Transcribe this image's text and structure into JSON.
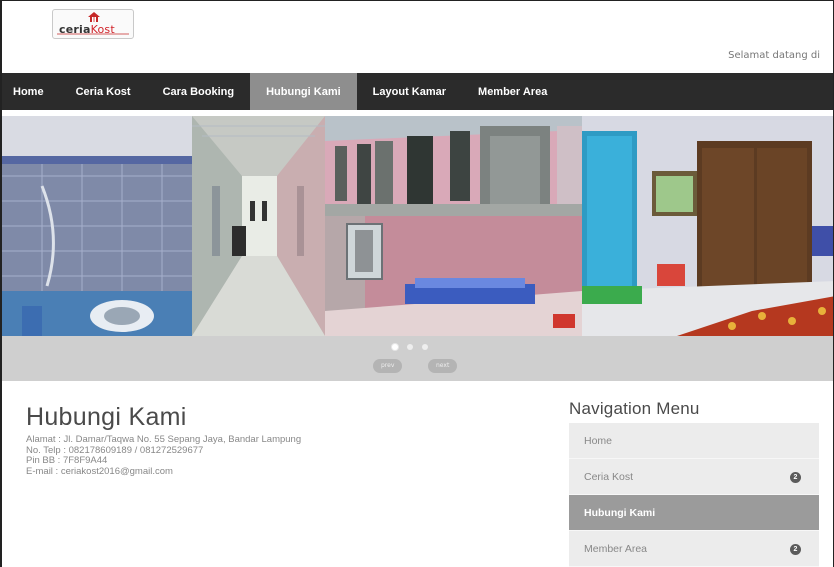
{
  "header": {
    "logo": {
      "part1": "ceria",
      "part2": "Kost"
    },
    "greeting": "Selamat datang di"
  },
  "nav": {
    "items": [
      {
        "label": "Home"
      },
      {
        "label": "Ceria Kost"
      },
      {
        "label": "Cara Booking"
      },
      {
        "label": "Hubungi Kami",
        "active": true
      },
      {
        "label": "Layout Kamar"
      },
      {
        "label": "Member Area"
      }
    ]
  },
  "slider": {
    "prev_label": "prev",
    "next_label": "next",
    "dots": 3,
    "active_dot": 1
  },
  "content": {
    "title": "Hubungi Kami",
    "lines": [
      "Alamat : Jl. Damar/Taqwa No. 55 Sepang Jaya, Bandar Lampung",
      "No. Telp : 082178609189 / 081272529677",
      "Pin BB : 7F8F9A44",
      "E-mail : ceriakost2016@gmail.com"
    ]
  },
  "sidebar": {
    "title": "Navigation Menu",
    "items": [
      {
        "label": "Home"
      },
      {
        "label": "Ceria Kost",
        "badge": "2"
      },
      {
        "label": "Hubungi Kami",
        "active": true
      },
      {
        "label": "Member Area",
        "badge": "2"
      }
    ]
  },
  "colors": {
    "navbar": "#2b2b2b",
    "nav_active": "#8e8e8e",
    "brand_red": "#d1232a",
    "sidebar_active": "#9b9b9b"
  }
}
